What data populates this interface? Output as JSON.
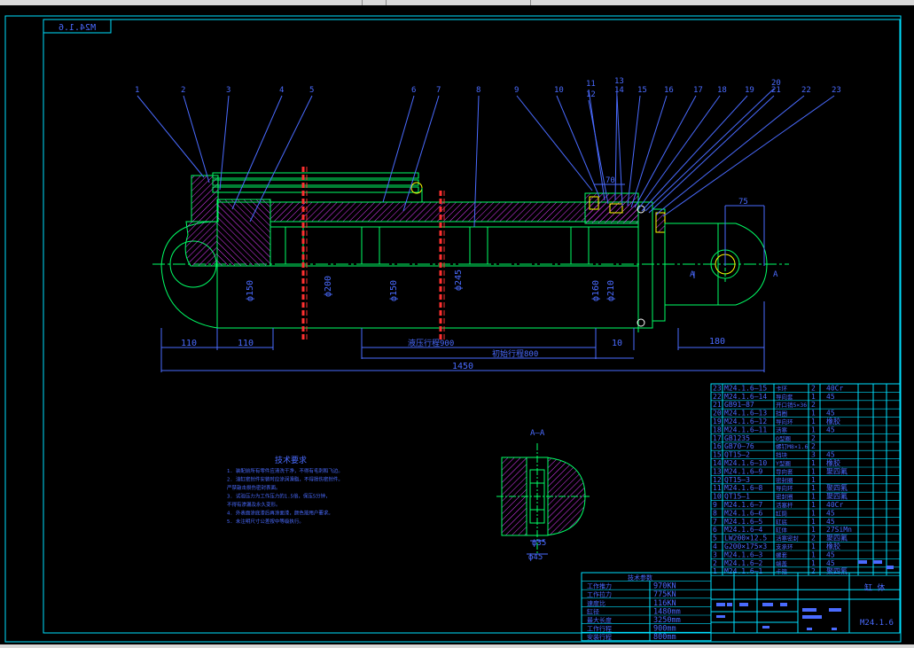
{
  "drawing": {
    "code_mirrored": "M24.1.6",
    "code": "M24.1.6",
    "title_block_label": "缸 体",
    "section_label": "A—A",
    "cut_marker": "A"
  },
  "tech_requirements": {
    "title": "技术要求",
    "lines": [
      "1. 装配前所有零件应清洗干净，不得有毛刺和飞边。",
      "2. 油缸密封件安装时应涂润滑脂，不得损伤密封件。",
      "   严禁敲击损伤密封表面。",
      "3. 试验压力为工作压力的1.5倍，保压5分钟，",
      "   不得有渗漏及永久变形。",
      "4. 外表面涂底漆后再涂面漆，颜色按用户要求。",
      "5. 未注明尺寸公差按中等级执行。"
    ]
  },
  "dimensions": {
    "d150_left": "ф150",
    "d200": "ф200",
    "d150_mid": "ф150",
    "d245": "ф245",
    "d160": "ф160",
    "d210": "ф210",
    "r70": "70",
    "r75": "75",
    "d110a": "110",
    "d110b": "110",
    "d10": "10",
    "d180": "180",
    "d1450": "1450",
    "stroke_label": "液压行程900",
    "install_label": "初始行程800",
    "d35": "ф35",
    "d45": "ф45"
  },
  "balloons": [
    "1",
    "2",
    "3",
    "4",
    "5",
    "6",
    "7",
    "8",
    "9",
    "10",
    "11",
    "12",
    "13",
    "14",
    "15",
    "16",
    "17",
    "18",
    "19",
    "20",
    "21",
    "22",
    "23"
  ],
  "bom": [
    {
      "no": "23",
      "code": "M24.1.6—15",
      "name": "卡环",
      "qty": "2",
      "mat": "40Cr"
    },
    {
      "no": "22",
      "code": "M24.1.6—14",
      "name": "导向套",
      "qty": "1",
      "mat": "45"
    },
    {
      "no": "21",
      "code": "GB91—87",
      "name": "开口销5×36",
      "qty": "2",
      "mat": ""
    },
    {
      "no": "20",
      "code": "M24.1.6—13",
      "name": "挡圈",
      "qty": "1",
      "mat": "45"
    },
    {
      "no": "19",
      "code": "M24.1.6—12",
      "name": "导向环",
      "qty": "1",
      "mat": "橡胶"
    },
    {
      "no": "18",
      "code": "M24.1.6—11",
      "name": "活塞",
      "qty": "1",
      "mat": "45"
    },
    {
      "no": "17",
      "code": "GB1235",
      "name": "O型圈",
      "qty": "2",
      "mat": ""
    },
    {
      "no": "16",
      "code": "GB70—76",
      "name": "螺钉M8×1.6",
      "qty": "2",
      "mat": ""
    },
    {
      "no": "15",
      "code": "QT15—2",
      "name": "挡块",
      "qty": "3",
      "mat": "45"
    },
    {
      "no": "14",
      "code": "M24.1.6—10",
      "name": "Y型圈",
      "qty": "1",
      "mat": "橡胶"
    },
    {
      "no": "13",
      "code": "M24.1.6—9",
      "name": "导向套",
      "qty": "1",
      "mat": "聚四氟"
    },
    {
      "no": "12",
      "code": "QT15—3",
      "name": "密封圈",
      "qty": "1",
      "mat": ""
    },
    {
      "no": "11",
      "code": "M24.1.6—8",
      "name": "导向环",
      "qty": "1",
      "mat": "聚四氟"
    },
    {
      "no": "10",
      "code": "QT15—1",
      "name": "密封圈",
      "qty": "1",
      "mat": "聚四氟"
    },
    {
      "no": "9",
      "code": "M24.1.6—7",
      "name": "活塞杆",
      "qty": "1",
      "mat": "40Cr"
    },
    {
      "no": "8",
      "code": "M24.1.6—6",
      "name": "缸筒",
      "qty": "1",
      "mat": "45"
    },
    {
      "no": "7",
      "code": "M24.1.6—5",
      "name": "缸底",
      "qty": "1",
      "mat": "45"
    },
    {
      "no": "6",
      "code": "M24.1.6—4",
      "name": "缸体",
      "qty": "1",
      "mat": "27SiMn"
    },
    {
      "no": "5",
      "code": "LW200×12.5",
      "name": "活塞密封",
      "qty": "2",
      "mat": "聚四氟"
    },
    {
      "no": "4",
      "code": "G200×175×3",
      "name": "支承环",
      "qty": "1",
      "mat": "橡胶"
    },
    {
      "no": "3",
      "code": "M24.1.6—3",
      "name": "螺套",
      "qty": "1",
      "mat": "45"
    },
    {
      "no": "2",
      "code": "M24.1.6—2",
      "name": "端盖",
      "qty": "1",
      "mat": "45"
    },
    {
      "no": "1",
      "code": "M24.1.6—1",
      "name": "卡箍",
      "qty": "2",
      "mat": "聚四氟"
    }
  ],
  "params": {
    "title": "技术参数",
    "rows": [
      {
        "k": "工作推力",
        "v": "970KN"
      },
      {
        "k": "工作拉力",
        "v": "775KN"
      },
      {
        "k": "速度比",
        "v": "116KN"
      },
      {
        "k": "缸径",
        "v": "1480mm"
      },
      {
        "k": "最大长度",
        "v": "3250mm"
      },
      {
        "k": "工作行程",
        "v": "900mm"
      },
      {
        "k": "安装行程",
        "v": "800mm"
      }
    ]
  },
  "colors": {
    "background": "#000000",
    "frame": "#00e0ff",
    "part_line": "#00ff66",
    "leader": "#4a6bff",
    "hatch": "#e03cff",
    "center": "#00ff66",
    "tie_rod": "#ff3030",
    "text": "#4a6bff",
    "seal": "#ffff00",
    "white": "#ffffff"
  }
}
